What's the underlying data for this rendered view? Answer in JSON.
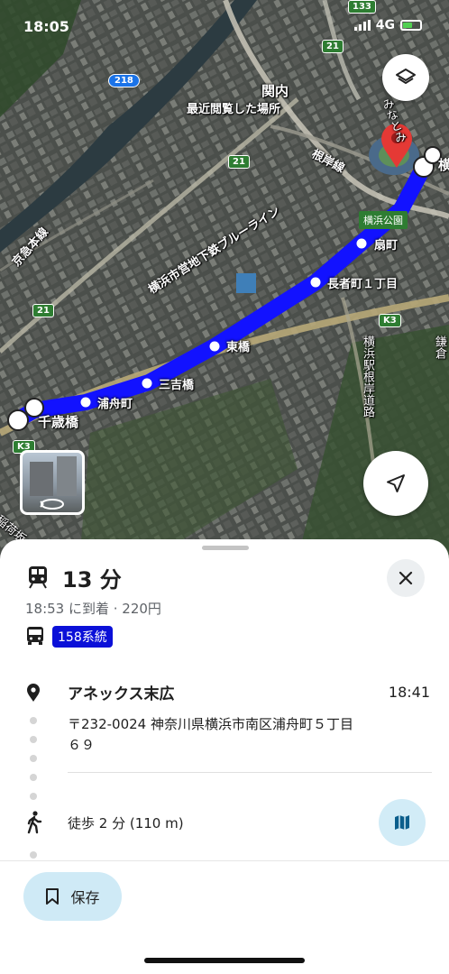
{
  "status_bar": {
    "time": "18:05",
    "network": "4G"
  },
  "map": {
    "labels": {
      "sekinai": "関内",
      "recent_place": "最近閲覧した場所",
      "negishi_line": "根岸線",
      "keikyu_line": "京急本線",
      "blueline": "横浜市営地下鉄ブルーライン",
      "yokohama_park": "横浜公園",
      "ohgimachi": "扇町",
      "choujamachi": "長者町１丁目",
      "higashibashi": "東橋",
      "sankyobashi": "三吉橋",
      "urafunecho": "浦舟町",
      "chitosebashi": "千歳橋",
      "yokohama_station_road": "横浜駅根岸道路",
      "kamakura_road": "鎌倉",
      "inarizaka": "稲荷坂",
      "minatomirai": "みなとみ",
      "station_cut": "横"
    },
    "shields": {
      "r133": "133",
      "r21a": "21",
      "r21b": "21",
      "r21c": "21",
      "r218": "218",
      "k3a": "K3",
      "k3b": "K3"
    },
    "colors": {
      "route": "#1212ff",
      "pin": "#e53935"
    }
  },
  "sheet": {
    "duration": "13 分",
    "arrival": "18:53 に到着 · 220円",
    "line_badge": "158系統",
    "stop_name": "アネックス末広",
    "stop_time": "18:41",
    "address": "〒232-0024 神奈川県横浜市南区浦舟町５丁目６９",
    "walk": "徒歩 2 分 (110 m)",
    "save_label": "保存"
  },
  "icons": [
    "layers-icon",
    "navigate-icon",
    "streetview-icon",
    "train-icon",
    "close-icon",
    "bus-icon",
    "pin-icon",
    "walk-icon",
    "map-icon",
    "bookmark-icon"
  ]
}
